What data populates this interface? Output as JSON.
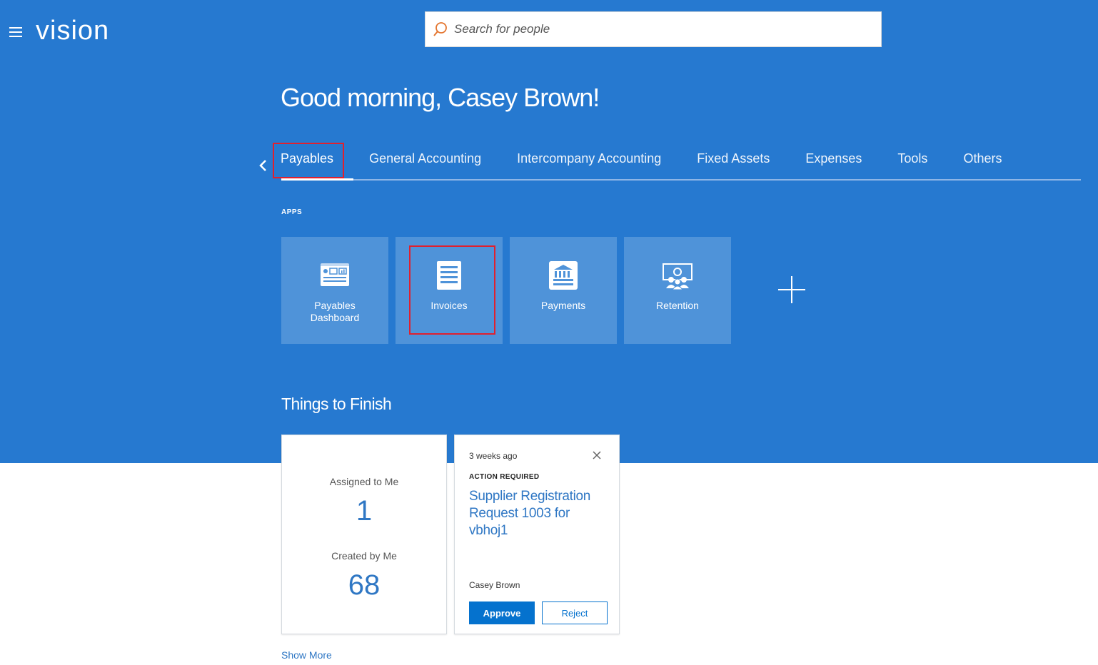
{
  "app": {
    "logo": "vision"
  },
  "search": {
    "placeholder": "Search for people"
  },
  "greeting": "Good morning, Casey Brown!",
  "tabs": [
    {
      "label": "Payables",
      "active": true
    },
    {
      "label": "General Accounting"
    },
    {
      "label": "Intercompany Accounting"
    },
    {
      "label": "Fixed Assets"
    },
    {
      "label": "Expenses"
    },
    {
      "label": "Tools"
    },
    {
      "label": "Others"
    }
  ],
  "apps": {
    "section_label": "APPS",
    "items": [
      {
        "label": "Payables Dashboard",
        "icon": "dashboard-icon"
      },
      {
        "label": "Invoices",
        "icon": "invoice-icon"
      },
      {
        "label": "Payments",
        "icon": "bank-icon"
      },
      {
        "label": "Retention",
        "icon": "retention-icon"
      }
    ]
  },
  "things_to_finish": {
    "title": "Things to Finish",
    "assigned_label": "Assigned to Me",
    "assigned_count": "1",
    "created_label": "Created by Me",
    "created_count": "68",
    "task": {
      "time": "3 weeks ago",
      "action": "ACTION REQUIRED",
      "title": "Supplier Registration Request 1003 for vbhoj1",
      "person": "Casey Brown",
      "approve_label": "Approve",
      "reject_label": "Reject"
    },
    "show_more": "Show More"
  },
  "colors": {
    "hero": "#2679d0",
    "tile": "#4f93d9",
    "link": "#2f77c4",
    "primary_button": "#0572ce",
    "highlight": "#e0202e"
  }
}
